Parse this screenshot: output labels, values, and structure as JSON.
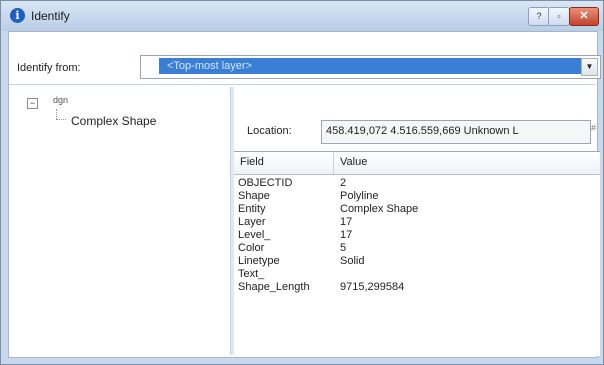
{
  "window": {
    "title": "Identify",
    "help_glyph": "?",
    "dock_glyph": "▫",
    "close_glyph": "✕"
  },
  "identify_from": {
    "label": "Identify from:",
    "value": "<Top-most layer>",
    "arrow": "▼"
  },
  "tree": {
    "expander": "−",
    "root_label": "dgn",
    "child_label": "Complex Shape"
  },
  "location": {
    "label": "Location:",
    "value": "458.419,072  4.516.559,669 Unknown L",
    "pin": "#"
  },
  "table": {
    "headers": [
      "Field",
      "Value"
    ],
    "rows": [
      {
        "field": "OBJECTID",
        "value": "2"
      },
      {
        "field": "Shape",
        "value": "Polyline"
      },
      {
        "field": "Entity",
        "value": "Complex Shape"
      },
      {
        "field": "Layer",
        "value": "17"
      },
      {
        "field": "Level_",
        "value": "17"
      },
      {
        "field": "Color",
        "value": "5"
      },
      {
        "field": "Linetype",
        "value": "Solid"
      },
      {
        "field": "Text_",
        "value": ""
      },
      {
        "field": "Shape_Length",
        "value": "9715,299584"
      }
    ]
  }
}
